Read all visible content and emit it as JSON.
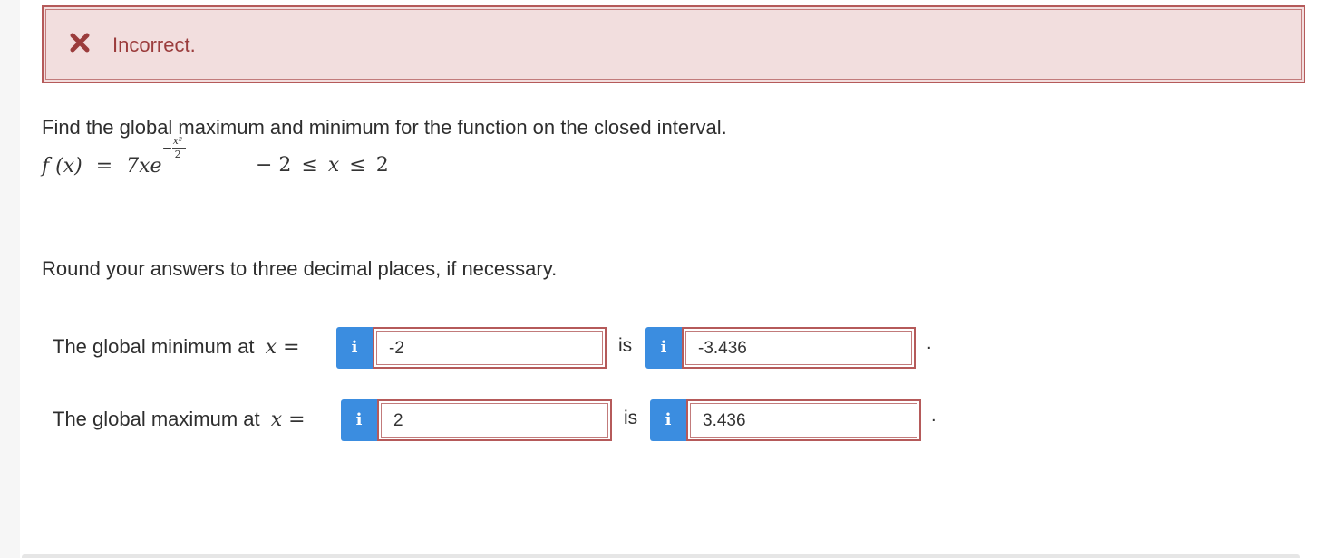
{
  "alert": {
    "icon": "x-mark-icon",
    "text": "Incorrect.",
    "color": "#9b3c3c",
    "background": "#f2dede"
  },
  "question": {
    "prompt": "Find the global maximum and minimum for the function on the closed interval.",
    "function": {
      "lhs": "f (x)",
      "eq": "=",
      "coef": "7xe",
      "exp_minus": "−",
      "exp_num": "x²",
      "exp_den": "2"
    },
    "interval": {
      "lower": "− 2",
      "le1": "≤",
      "var": "x",
      "le2": "≤",
      "upper": "2"
    },
    "rounding_note": "Round your answers to three decimal places, if necessary."
  },
  "answers": {
    "minimum": {
      "label": "The global minimum at",
      "var": "x =",
      "x_value": "-2",
      "is_label": "is",
      "y_value": "-3.436",
      "period": "."
    },
    "maximum": {
      "label": "The global maximum at",
      "var": "x =",
      "x_value": "2",
      "is_label": "is",
      "y_value": "3.436",
      "period": "."
    },
    "info_icon_label": "i"
  }
}
